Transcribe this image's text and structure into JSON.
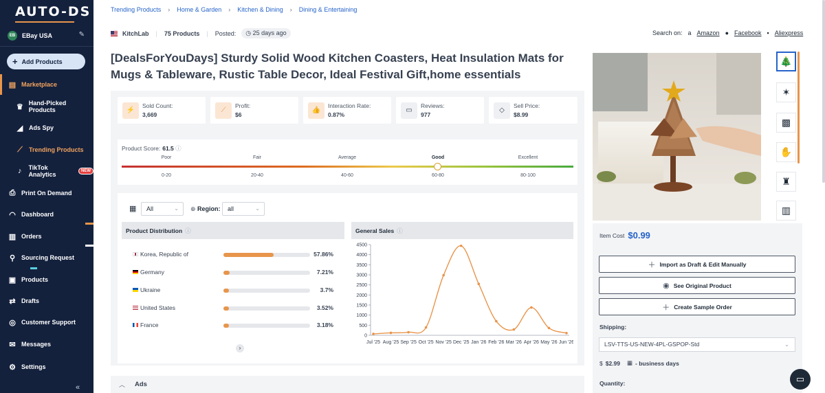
{
  "brand": {
    "logo": "AUTO-DS"
  },
  "store": {
    "badge": "EB",
    "name": "EBay USA"
  },
  "sidebar": {
    "add_button": "Add Products",
    "items": [
      {
        "label": "Marketplace",
        "icon": "store-icon"
      },
      {
        "label": "Hand-Picked Products",
        "icon": "crown-icon"
      },
      {
        "label": "Ads Spy",
        "icon": "megaphone-icon"
      },
      {
        "label": "Trending Products",
        "icon": "trend-icon"
      },
      {
        "label": "TikTok Analytics",
        "icon": "tiktok-icon",
        "badge": "NEW"
      },
      {
        "label": "Print On Demand",
        "icon": "printer-icon"
      },
      {
        "label": "Dashboard",
        "icon": "gauge-icon"
      },
      {
        "label": "Orders",
        "icon": "clipboard-icon"
      },
      {
        "label": "Sourcing Request",
        "icon": "sourcing-icon"
      },
      {
        "label": "Products",
        "icon": "box-icon"
      },
      {
        "label": "Drafts",
        "icon": "drafts-icon"
      },
      {
        "label": "Customer Support",
        "icon": "support-icon"
      },
      {
        "label": "Messages",
        "icon": "mail-icon"
      },
      {
        "label": "Settings",
        "icon": "gear-icon"
      }
    ],
    "collapse": "«"
  },
  "breadcrumb": [
    "Trending Products",
    "Home & Garden",
    "Kitchen & Dining",
    "Dining & Entertaining"
  ],
  "meta": {
    "seller": "KitchLab",
    "products": "75 Products",
    "posted_label": "Posted:",
    "posted_value": "25 days ago"
  },
  "search_on": {
    "label": "Search on:",
    "links": [
      "Amazon",
      "Facebook",
      "Aliexpress"
    ]
  },
  "product": {
    "title": "[DealsForYouDays] Sturdy Solid Wood Kitchen Coasters, Heat Insulation Mats for Mugs & Tableware, Rustic Table Decor, Ideal Festival Gift,home essentials"
  },
  "stats": [
    {
      "label": "Sold Count:",
      "value": "3,669",
      "icon": "bolt-icon"
    },
    {
      "label": "Profit:",
      "value": "$6",
      "icon": "chart-icon"
    },
    {
      "label": "Interaction Rate:",
      "value": "0.87%",
      "icon": "thumbs-up-icon"
    },
    {
      "label": "Reviews:",
      "value": "977",
      "icon": "comment-icon"
    },
    {
      "label": "Sell Price:",
      "value": "$8.99",
      "icon": "tag-icon"
    }
  ],
  "score": {
    "label": "Product Score:",
    "value": "61.5",
    "levels": [
      "Poor",
      "Fair",
      "Average",
      "Good",
      "Excellent"
    ],
    "ranges": [
      "0-20",
      "20-40",
      "40-60",
      "60-80",
      "80-100"
    ],
    "active_level": "Good"
  },
  "filters": {
    "period": "All",
    "region_label": "Region:",
    "region": "all"
  },
  "distribution": {
    "title": "Product Distribution",
    "rows": [
      {
        "country": "Korea, Republic of",
        "pct": "57.86%",
        "value": 57.86
      },
      {
        "country": "Germany",
        "pct": "7.21%",
        "value": 7.21
      },
      {
        "country": "Ukraine",
        "pct": "3.7%",
        "value": 3.7
      },
      {
        "country": "United States",
        "pct": "3.52%",
        "value": 3.52
      },
      {
        "country": "France",
        "pct": "3.18%",
        "value": 3.18
      }
    ]
  },
  "chart_data": {
    "type": "line",
    "title": "General Sales",
    "categories": [
      "Jul '25",
      "Aug '25",
      "Sep '25",
      "Oct '25",
      "Nov '25",
      "Dec '25",
      "Jan '26",
      "Feb '26",
      "Mar '26",
      "Apr '26",
      "May '26",
      "Jun '26"
    ],
    "series": [
      {
        "values": [
          70,
          120,
          150,
          390,
          2980,
          4440,
          2550,
          700,
          290,
          1380,
          360,
          110
        ]
      }
    ],
    "ylim": [
      0,
      4500
    ],
    "yticks": [
      0,
      500,
      1000,
      1500,
      2000,
      2500,
      3000,
      3500,
      4000,
      4500
    ],
    "color": "#e8954b",
    "grid": false
  },
  "ads_section": {
    "label": "Ads"
  },
  "purchase": {
    "item_cost_label": "Item Cost",
    "item_cost": "$0.99",
    "buttons": [
      "Import as Draft & Edit Manually",
      "See Original Product",
      "Create Sample Order"
    ],
    "shipping_label": "Shipping:",
    "shipping_method": "LSV-TTS-US-NEW-4PL-GSPOP-Std",
    "shipping_cost": "$2.99",
    "shipping_days": "- business days",
    "quantity_label": "Quantity:"
  },
  "colors": {
    "sidebar": "#14213d",
    "accent": "#e8954b",
    "link": "#2563c9"
  }
}
